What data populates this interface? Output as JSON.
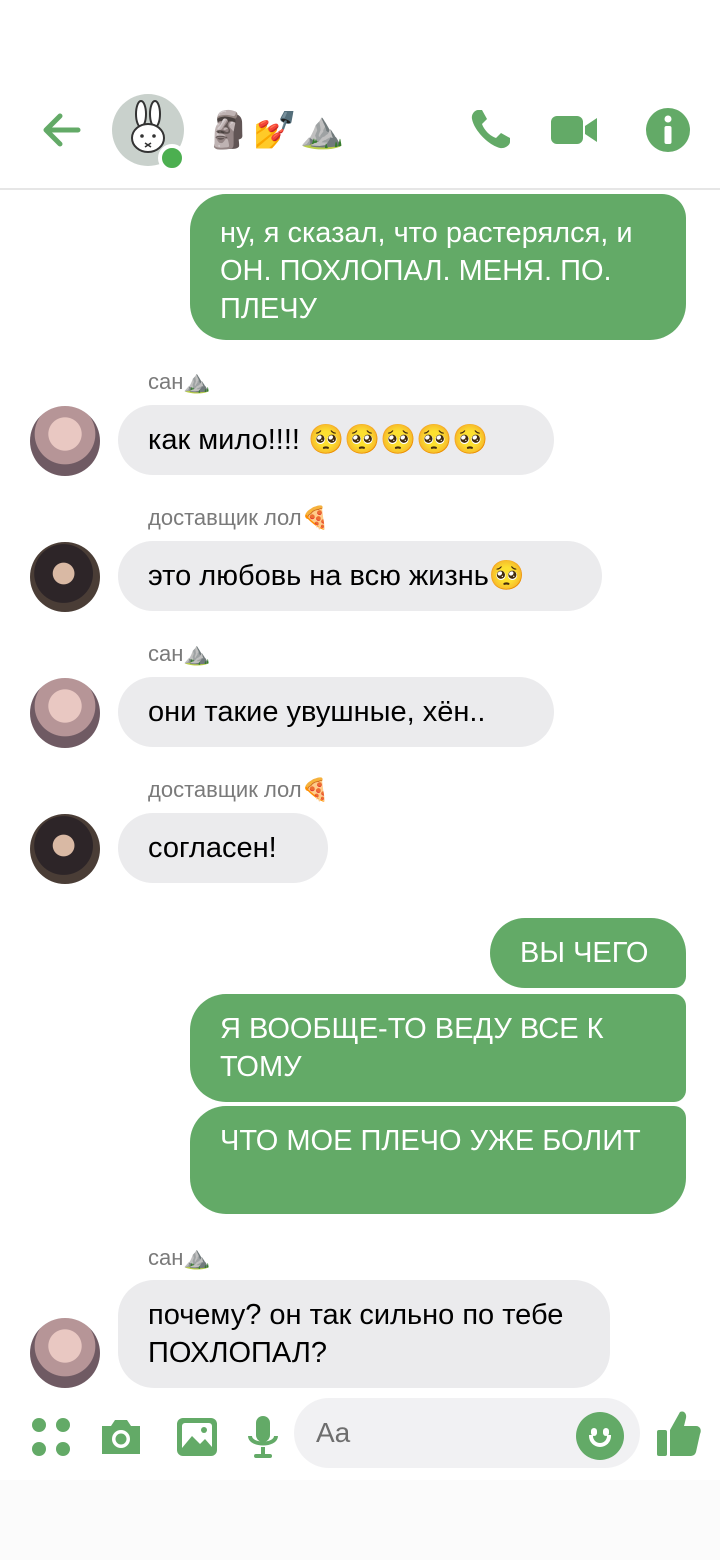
{
  "header": {
    "title": "🗿💅⛰️",
    "icons": {
      "back": "arrow-left-icon",
      "call": "phone-icon",
      "video": "video-camera-icon",
      "info": "info-icon"
    },
    "accent_color": "#63aa67"
  },
  "messages": [
    {
      "direction": "outgoing",
      "text": "ну, я сказал, что растерялся, и ОН. ПОХЛОПАЛ. МЕНЯ. ПО. ПЛЕЧУ"
    },
    {
      "direction": "incoming",
      "sender": "сан⛰️",
      "text": "как мило!!!! 🥺🥺🥺🥺🥺"
    },
    {
      "direction": "incoming",
      "sender": "доставщик лол🍕",
      "text": "это любовь на всю жизнь🥺"
    },
    {
      "direction": "incoming",
      "sender": "сан⛰️",
      "text": "они такие увушные, хён.."
    },
    {
      "direction": "incoming",
      "sender": "доставщик лол🍕",
      "text": "согласен!"
    },
    {
      "direction": "outgoing",
      "text": "ВЫ ЧЕГО"
    },
    {
      "direction": "outgoing",
      "text": "Я ВООБЩЕ-ТО ВЕДУ ВСЕ К ТОМУ"
    },
    {
      "direction": "outgoing",
      "text": "ЧТО МОЕ ПЛЕЧО УЖЕ БОЛИТ"
    },
    {
      "direction": "incoming",
      "sender": "сан⛰️",
      "text": "почему? он так сильно по тебе ПОХЛОПАЛ?"
    }
  ],
  "composer": {
    "placeholder": "Aa",
    "icons": [
      "apps-grid-icon",
      "camera-icon",
      "image-icon",
      "microphone-icon",
      "smiley-icon",
      "thumbs-up-icon"
    ]
  }
}
